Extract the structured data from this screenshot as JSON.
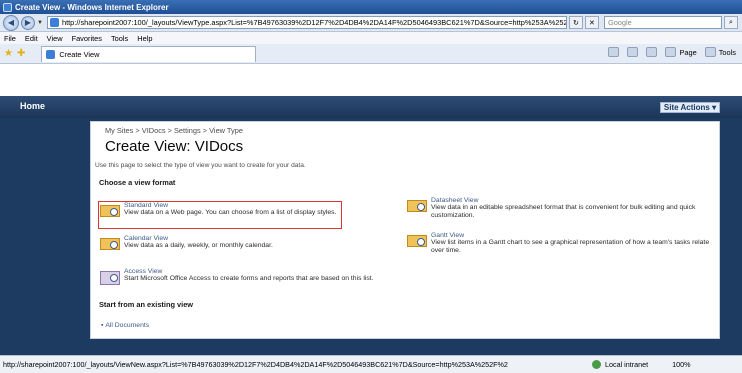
{
  "window": {
    "title": "Create View - Windows Internet Explorer"
  },
  "address": {
    "url": "http://sharepoint2007:100/_layouts/ViewType.aspx?List=%7B49763039%2D12F7%2D4DB4%2DA14F%2D5046493BC621%7D&Source=http%253A%252F%252Fshar",
    "search_placeholder": "Google"
  },
  "menu": [
    "File",
    "Edit",
    "View",
    "Favorites",
    "Tools",
    "Help"
  ],
  "tab": {
    "label": "Create View"
  },
  "commands": {
    "page": "Page",
    "tools": "Tools"
  },
  "site": {
    "home": "Home",
    "site_actions": "Site Actions"
  },
  "breadcrumb": "My Sites > VIDocs > Settings > View Type",
  "page_title": "Create View: VIDocs",
  "page_description": "Use this page to select the type of view you want to create for your data.",
  "choose_heading": "Choose a view format",
  "formats": {
    "standard": {
      "name": "Standard View",
      "desc": "View data on a Web page. You can choose from a list of display styles."
    },
    "datasheet": {
      "name": "Datasheet View",
      "desc1": "View data in an editable spreadsheet format that is convenient for bulk editing and quick",
      "desc2": "customization."
    },
    "calendar": {
      "name": "Calendar View",
      "desc": "View data as a daily, weekly, or monthly calendar."
    },
    "gantt": {
      "name": "Gantt View",
      "desc1": "View list items in a Gantt chart to see a graphical representation of how a team's tasks relate",
      "desc2": "over time."
    },
    "access": {
      "name": "Access View",
      "desc": "Start Microsoft Office Access to create forms and reports that are based on this list."
    }
  },
  "existing_heading": "Start from an existing view",
  "existing_views": {
    "all_documents": "All Documents"
  },
  "status": {
    "url": "http://sharepoint2007:100/_layouts/ViewNew.aspx?List=%7B49763039%2D12F7%2D4DB4%2DA14F%2D5046493BC621%7D&Source=http%253A%252F%2",
    "zone": "Local intranet",
    "zoom": "100%"
  }
}
